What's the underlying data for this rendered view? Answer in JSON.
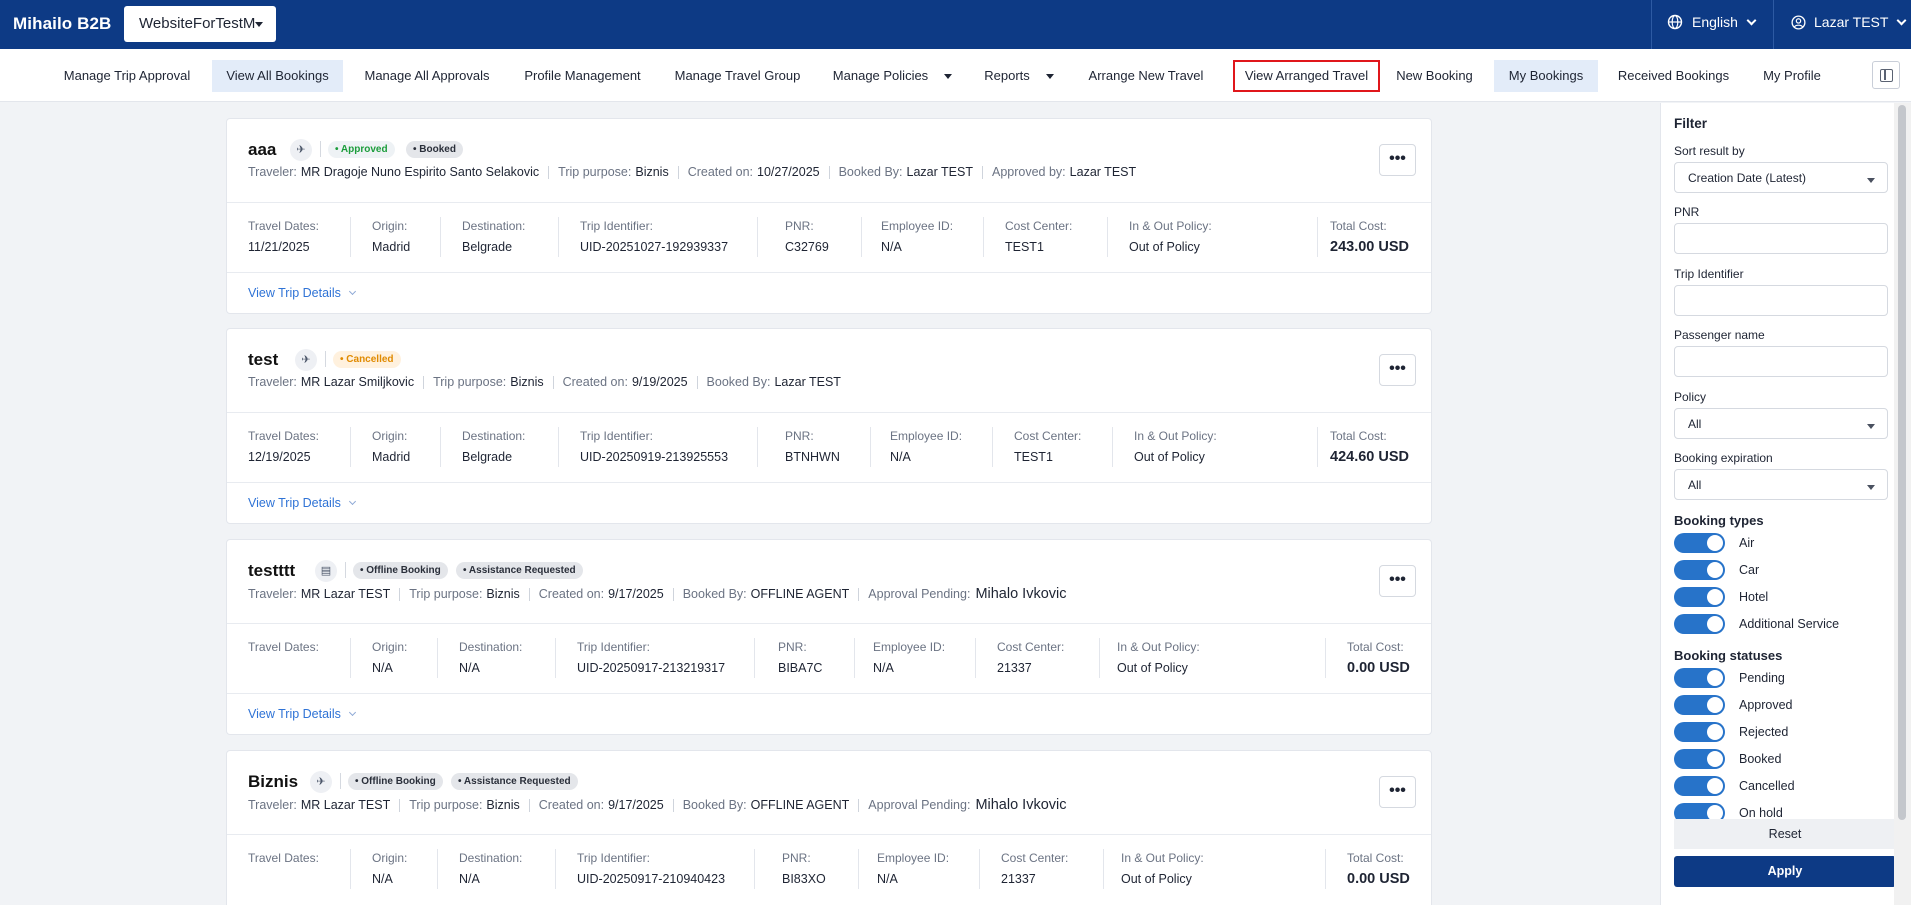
{
  "brand": "Mihailo B2B",
  "site_selector": {
    "value": "WebsiteForTestM"
  },
  "language": {
    "label": "English",
    "icon": "globe-icon"
  },
  "user": {
    "label": "Lazar TEST",
    "icon": "user-circle-icon"
  },
  "nav": {
    "items": [
      {
        "label": "Manage Trip Approval"
      },
      {
        "label": "View All Bookings",
        "active": true
      },
      {
        "label": "Manage All Approvals"
      },
      {
        "label": "Profile Management"
      },
      {
        "label": "Manage Travel Group"
      },
      {
        "label": "Manage Policies",
        "dropdown": true
      },
      {
        "label": "Reports",
        "dropdown": true
      },
      {
        "label": "Arrange New Travel"
      },
      {
        "label": "View Arranged Travel",
        "highlighted": true
      },
      {
        "label": "New Booking"
      },
      {
        "label": "My Bookings",
        "active": true
      },
      {
        "label": "Received Bookings"
      },
      {
        "label": "My Profile"
      }
    ],
    "panel_toggle_icon": "sidebar-panel-icon"
  },
  "labels": {
    "traveler": "Traveler:",
    "trip_purpose": "Trip purpose:",
    "created_on": "Created on:",
    "booked_by": "Booked By:",
    "approved_by": "Approved by:",
    "approval_pending": "Approval Pending:",
    "travel_dates": "Travel Dates:",
    "origin": "Origin:",
    "destination": "Destination:",
    "trip_identifier": "Trip Identifier:",
    "pnr": "PNR:",
    "employee_id": "Employee ID:",
    "cost_center": "Cost Center:",
    "policy": "In & Out Policy:",
    "total_cost": "Total Cost:",
    "view_details": "View Trip Details",
    "more": "•••"
  },
  "bookings": [
    {
      "title": "aaa",
      "type_icon": "airplane-icon",
      "badges": [
        "• Approved",
        "• Booked"
      ],
      "traveler": "MR Dragoje Nuno Espirito Santo Selakovic",
      "trip_purpose": "Biznis",
      "created_on": "10/27/2025",
      "booked_by": "Lazar TEST",
      "approved_by": "Lazar TEST",
      "travel_dates": "11/21/2025",
      "origin": "Madrid",
      "destination": "Belgrade",
      "trip_identifier": "UID-20251027-192939337",
      "pnr": "C32769",
      "employee_id": "N/A",
      "cost_center": "TEST1",
      "policy": "Out of Policy",
      "total_cost": "243.00 USD"
    },
    {
      "title": "test",
      "type_icon": "airplane-icon",
      "badges": [
        "• Cancelled"
      ],
      "traveler": "MR Lazar Smiljkovic",
      "trip_purpose": "Biznis",
      "created_on": "9/19/2025",
      "booked_by": "Lazar TEST",
      "travel_dates": "12/19/2025",
      "origin": "Madrid",
      "destination": "Belgrade",
      "trip_identifier": "UID-20250919-213925553",
      "pnr": "BTNHWN",
      "employee_id": "N/A",
      "cost_center": "TEST1",
      "policy": "Out of Policy",
      "total_cost": "424.60 USD"
    },
    {
      "title": "testttt",
      "type_icon": "building-icon",
      "badges": [
        "• Offline Booking",
        "• Assistance Requested"
      ],
      "traveler": "MR Lazar TEST",
      "trip_purpose": "Biznis",
      "created_on": "9/17/2025",
      "booked_by": "OFFLINE AGENT",
      "approval_pending": "Mihalo Ivkovic",
      "travel_dates": "",
      "origin": "N/A",
      "destination": "N/A",
      "trip_identifier": "UID-20250917-213219317",
      "pnr": "BIBA7C",
      "employee_id": "N/A",
      "cost_center": "21337",
      "policy": "Out of Policy",
      "total_cost": "0.00 USD"
    },
    {
      "title": "Biznis",
      "type_icon": "airplane-icon",
      "badges": [
        "• Offline Booking",
        "• Assistance Requested"
      ],
      "traveler": "MR Lazar TEST",
      "trip_purpose": "Biznis",
      "created_on": "9/17/2025",
      "booked_by": "OFFLINE AGENT",
      "approval_pending": "Mihalo Ivkovic",
      "travel_dates": "",
      "origin": "N/A",
      "destination": "N/A",
      "trip_identifier": "UID-20250917-210940423",
      "pnr": "BI83XO",
      "employee_id": "N/A",
      "cost_center": "21337",
      "policy": "Out of Policy",
      "total_cost": "0.00 USD"
    }
  ],
  "filter": {
    "title": "Filter",
    "sort_label": "Sort result by",
    "sort_value": "Creation Date (Latest)",
    "pnr_label": "PNR",
    "trip_identifier_label": "Trip Identifier",
    "passenger_label": "Passenger name",
    "policy_label": "Policy",
    "policy_value": "All",
    "expiration_label": "Booking expiration",
    "expiration_value": "All",
    "booking_types_title": "Booking types",
    "booking_types": [
      "Air",
      "Car",
      "Hotel",
      "Additional Service"
    ],
    "booking_statuses_title": "Booking statuses",
    "booking_statuses": [
      "Pending",
      "Approved",
      "Rejected",
      "Booked",
      "Cancelled",
      "On hold"
    ],
    "reset": "Reset",
    "apply": "Apply"
  },
  "colors": {
    "brand": "#0d3a85",
    "accent": "#2773c9",
    "approved": "#1c9d3c",
    "cancelled": "#e08a00",
    "highlight_border": "#e0161b"
  }
}
